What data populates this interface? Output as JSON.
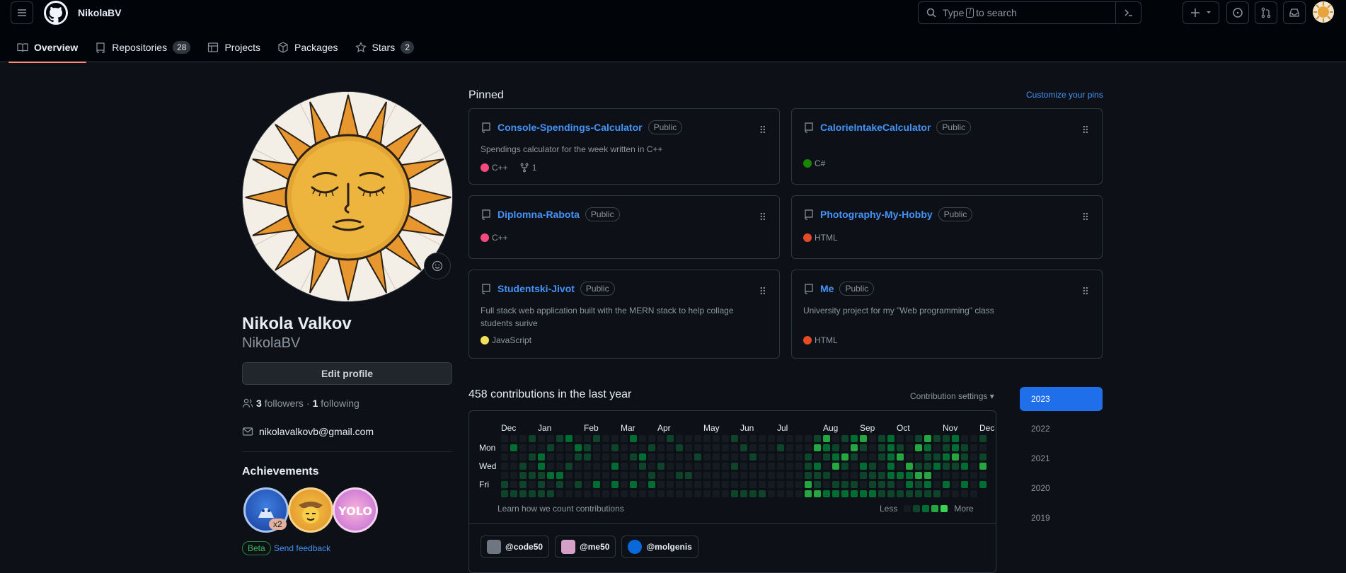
{
  "header": {
    "username": "NikolaBV",
    "search_prefix": "Type",
    "search_key": "/",
    "search_suffix": "to search"
  },
  "tabs": [
    {
      "label": "Overview",
      "active": true
    },
    {
      "label": "Repositories",
      "count": "28"
    },
    {
      "label": "Projects"
    },
    {
      "label": "Packages"
    },
    {
      "label": "Stars",
      "count": "2"
    }
  ],
  "profile": {
    "full_name": "Nikola Valkov",
    "login": "NikolaBV",
    "edit_label": "Edit profile",
    "followers_count": "3",
    "followers_label": "followers",
    "separator": "·",
    "following_count": "1",
    "following_label": "following",
    "email": "nikolavalkovb@gmail.com"
  },
  "achievements": {
    "title": "Achievements",
    "multiplier": "x2",
    "beta_label": "Beta",
    "feedback_label": "Send feedback"
  },
  "pinned": {
    "title": "Pinned",
    "customize_label": "Customize your pins",
    "repos": [
      {
        "name": "Console-Spendings-Calculator",
        "visibility": "Public",
        "description": "Spendings calculator for the week written in C++",
        "language": "C++",
        "language_color": "#f34b7d",
        "forks": "1"
      },
      {
        "name": "CalorieIntakeCalculator",
        "visibility": "Public",
        "description": "",
        "language": "C#",
        "language_color": "#178600"
      },
      {
        "name": "Diplomna-Rabota",
        "visibility": "Public",
        "description": "",
        "language": "C++",
        "language_color": "#f34b7d"
      },
      {
        "name": "Photography-My-Hobby",
        "visibility": "Public",
        "description": "",
        "language": "HTML",
        "language_color": "#e34c26"
      },
      {
        "name": "Studentski-Jivot",
        "visibility": "Public",
        "description": "Full stack web application built with the MERN stack to help collage students surive",
        "language": "JavaScript",
        "language_color": "#f1e05a"
      },
      {
        "name": "Me",
        "visibility": "Public",
        "description": "University project for my \"Web programming\" class",
        "language": "HTML",
        "language_color": "#e34c26"
      }
    ]
  },
  "contributions": {
    "title": "458 contributions in the last year",
    "settings_label": "Contribution settings",
    "learn_label": "Learn how we count contributions",
    "less_label": "Less",
    "more_label": "More",
    "months": [
      "Dec",
      "Jan",
      "Feb",
      "Mar",
      "Apr",
      "May",
      "Jun",
      "Jul",
      "Aug",
      "Sep",
      "Oct",
      "Nov",
      "Dec"
    ],
    "day_labels": [
      "Mon",
      "Wed",
      "Fri"
    ],
    "level_colors": [
      "#161b22",
      "#0e4429",
      "#006d32",
      "#26a641",
      "#39d353"
    ]
  },
  "orgs": [
    {
      "label": "@code50",
      "color": "#6e7681"
    },
    {
      "label": "@me50",
      "color": "#d4a0c8"
    },
    {
      "label": "@molgenis",
      "color": "#0969da"
    }
  ],
  "years": [
    {
      "label": "2023",
      "active": true
    },
    {
      "label": "2022"
    },
    {
      "label": "2021"
    },
    {
      "label": "2020"
    },
    {
      "label": "2019"
    }
  ]
}
